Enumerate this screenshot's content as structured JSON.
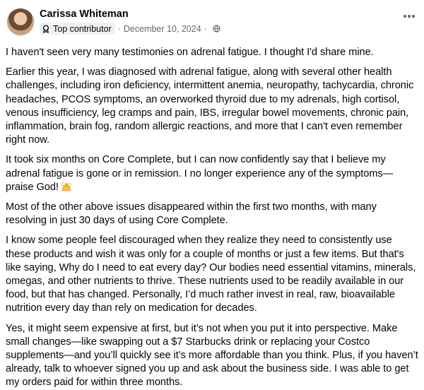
{
  "post": {
    "author": "Carissa Whiteman",
    "badge": "Top contributor",
    "separator": "·",
    "date": "December 10, 2024",
    "separator2": "·",
    "icons": {
      "avatar": "profile-photo",
      "badge": "contributor-badge-icon",
      "audience": "globe-icon",
      "more": "more-options-icon",
      "emoji": "raised-hands-emoji"
    },
    "paragraphs": [
      "I haven't seen very many testimonies on adrenal fatigue. I thought I'd share mine.",
      "Earlier this year, I was diagnosed with adrenal fatigue, along with several other health challenges, including iron deficiency, intermittent anemia, neuropathy, tachycardia, chronic headaches, PCOS symptoms, an overworked thyroid due to my adrenals, high cortisol, venous insufficiency, leg cramps and pain, IBS, irregular bowel movements, chronic pain, inflammation, brain fog, random allergic reactions, and more that I can't even remember right now.",
      "It took six months on Core Complete, but I can now confidently say that I believe my adrenal fatigue is gone or in remission. I no longer experience any of the symptoms—praise God!",
      "Most of the other above issues disappeared within the first two months, with many resolving in just 30 days of using Core Complete.",
      "I know some people feel discouraged when they realize they need to consistently use these products and wish it was only for a couple of months or just a few items. But that's like saying, Why do I need to eat every day? Our bodies need essential vitamins, minerals, omegas, and other nutrients to thrive. These nutrients used to be readily available in our food, but that has changed. Personally, I’d much rather invest in real, raw, bioavailable nutrition every day than rely on medication for decades.",
      "Yes, it might seem expensive at first, but it’s not when you put it into perspective. Make small changes—like swapping out a $7 Starbucks drink or replacing your Costco supplements—and you’ll quickly see it’s more affordable than you think. Plus, if you haven’t already, talk to whoever signed you up and ask about the business side. I was able to get my orders paid for within three months."
    ]
  }
}
